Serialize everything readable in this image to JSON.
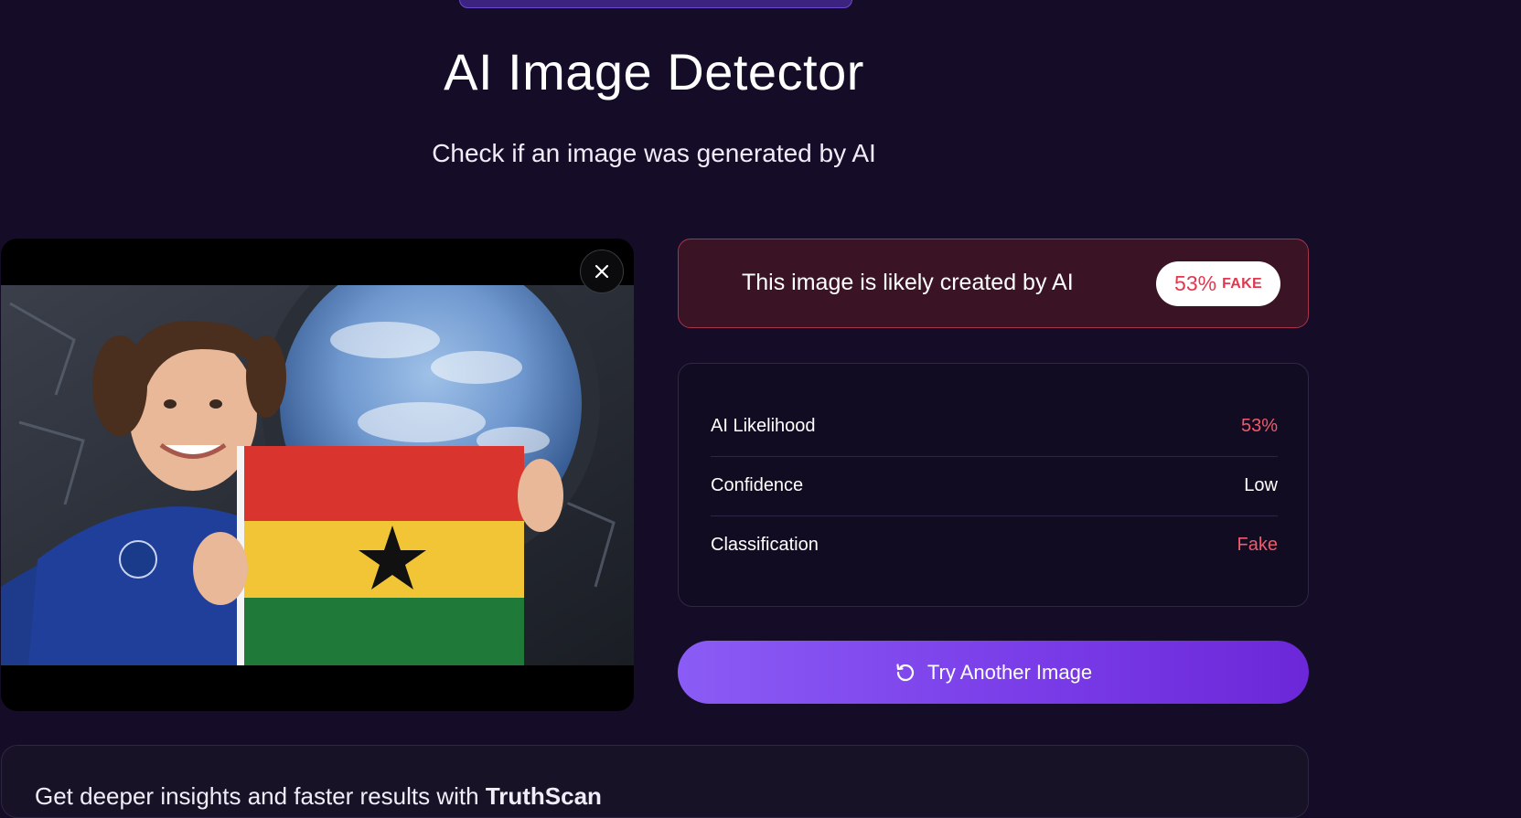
{
  "header": {
    "title": "AI Image Detector",
    "subtitle": "Check if an image was generated by AI"
  },
  "verdict": {
    "text": "This image is likely created by AI",
    "score_percent": "53%",
    "score_label": "FAKE"
  },
  "metrics": [
    {
      "label": "AI Likelihood",
      "value": "53%"
    },
    {
      "label": "Confidence",
      "value": "Low"
    },
    {
      "label": "Classification",
      "value": "Fake"
    }
  ],
  "actions": {
    "try_another_label": "Try Another Image"
  },
  "footer": {
    "text_prefix": "Get deeper insights and faster results with ",
    "brand": "TruthScan"
  },
  "icons": {
    "close": "close-icon",
    "refresh": "refresh-icon"
  },
  "colors": {
    "background": "#150d28",
    "fake_red": "#e0384f",
    "accent_purple": "#7a3de8"
  }
}
